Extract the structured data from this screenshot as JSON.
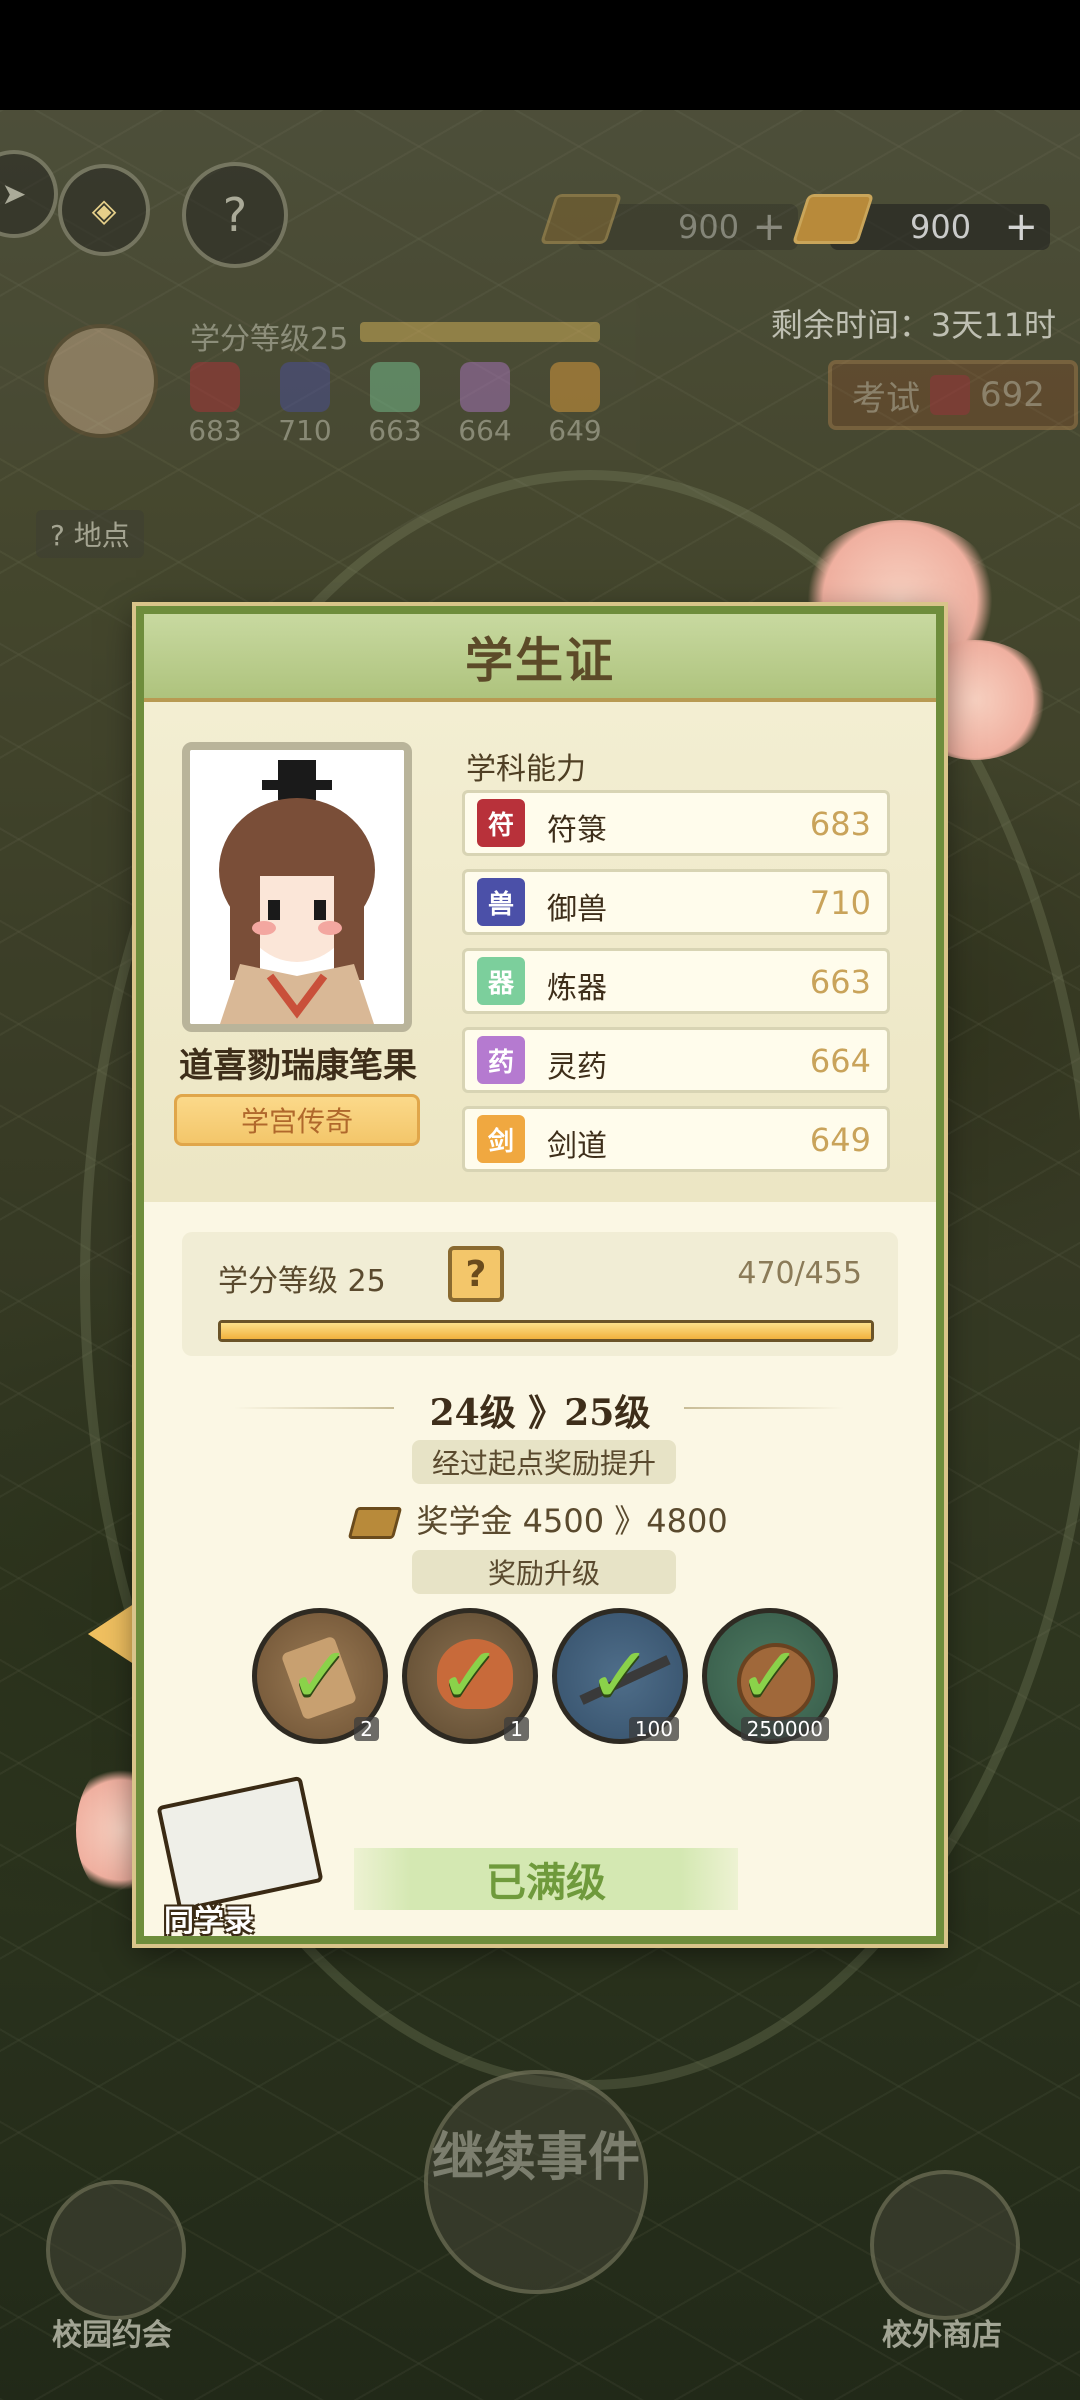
{
  "hud": {
    "currency1": "900",
    "currency2": "900",
    "plus": "+",
    "remaining_time": "剩余时间：3天11时",
    "exam_label": "考试",
    "exam_value": "692",
    "location_label": "地点",
    "question_mark": "?"
  },
  "profile_bar": {
    "level_text": "学分等级25",
    "stats": [
      "683",
      "710",
      "663",
      "664",
      "649"
    ]
  },
  "card": {
    "title": "学生证",
    "player_name": "道喜勠瑞康笔果",
    "player_title": "学宫传奇",
    "subjects_label": "学科能力",
    "subjects": [
      {
        "name": "符箓",
        "value": "683",
        "icon": "talisman-icon",
        "color": "#b8313a"
      },
      {
        "name": "御兽",
        "value": "710",
        "icon": "beast-icon",
        "color": "#4b50a8"
      },
      {
        "name": "炼器",
        "value": "663",
        "icon": "forge-icon",
        "color": "#7ccf9c"
      },
      {
        "name": "灵药",
        "value": "664",
        "icon": "herb-icon",
        "color": "#b57ad0"
      },
      {
        "name": "剑道",
        "value": "649",
        "icon": "sword-icon",
        "color": "#f0a840"
      }
    ],
    "level_label": "学分等级  25",
    "help": "?",
    "xp_text": "470/455",
    "xp_fraction": 1.0,
    "level_change": "24级 》25级",
    "start_reward_text": "经过起点奖励提升",
    "scholarship_text": "奖学金  4500 》4800",
    "upgrade_reward_label": "奖励升级",
    "rewards": [
      {
        "icon": "scroll-bundle-icon",
        "count": "2"
      },
      {
        "icon": "item-bag-icon",
        "count": "1"
      },
      {
        "icon": "gourd-staff-icon",
        "count": "100"
      },
      {
        "icon": "copper-coin-icon",
        "count": "250000"
      }
    ],
    "maxed_label": "已满级",
    "classmates_label": "同学录"
  },
  "bottom": {
    "continue_event": "继续事件",
    "campus_date": "校园约会",
    "outside_shop": "校外商店"
  }
}
